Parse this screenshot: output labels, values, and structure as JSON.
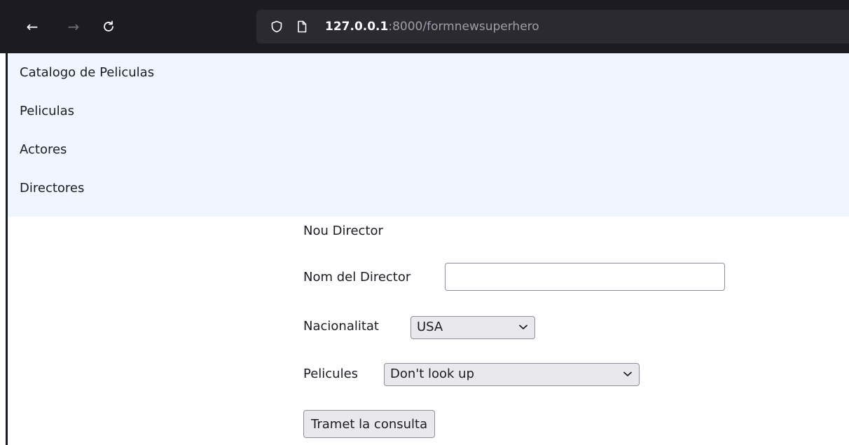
{
  "browser": {
    "url_host": "127.0.0.1",
    "url_rest": ":8000/formnewsuperhero",
    "back_icon": "←",
    "forward_icon": "→"
  },
  "nav": {
    "items": [
      {
        "label": "Catalogo de Peliculas"
      },
      {
        "label": "Peliculas"
      },
      {
        "label": "Actores"
      },
      {
        "label": "Directores"
      }
    ]
  },
  "form": {
    "title": "Nou Director",
    "name_label": "Nom del Director",
    "name_value": "",
    "nationality_label": "Nacionalitat",
    "nationality_selected": "USA",
    "movies_label": "Pelicules",
    "movies_selected": "Don't look up",
    "submit_label": "Tramet la consulta"
  }
}
